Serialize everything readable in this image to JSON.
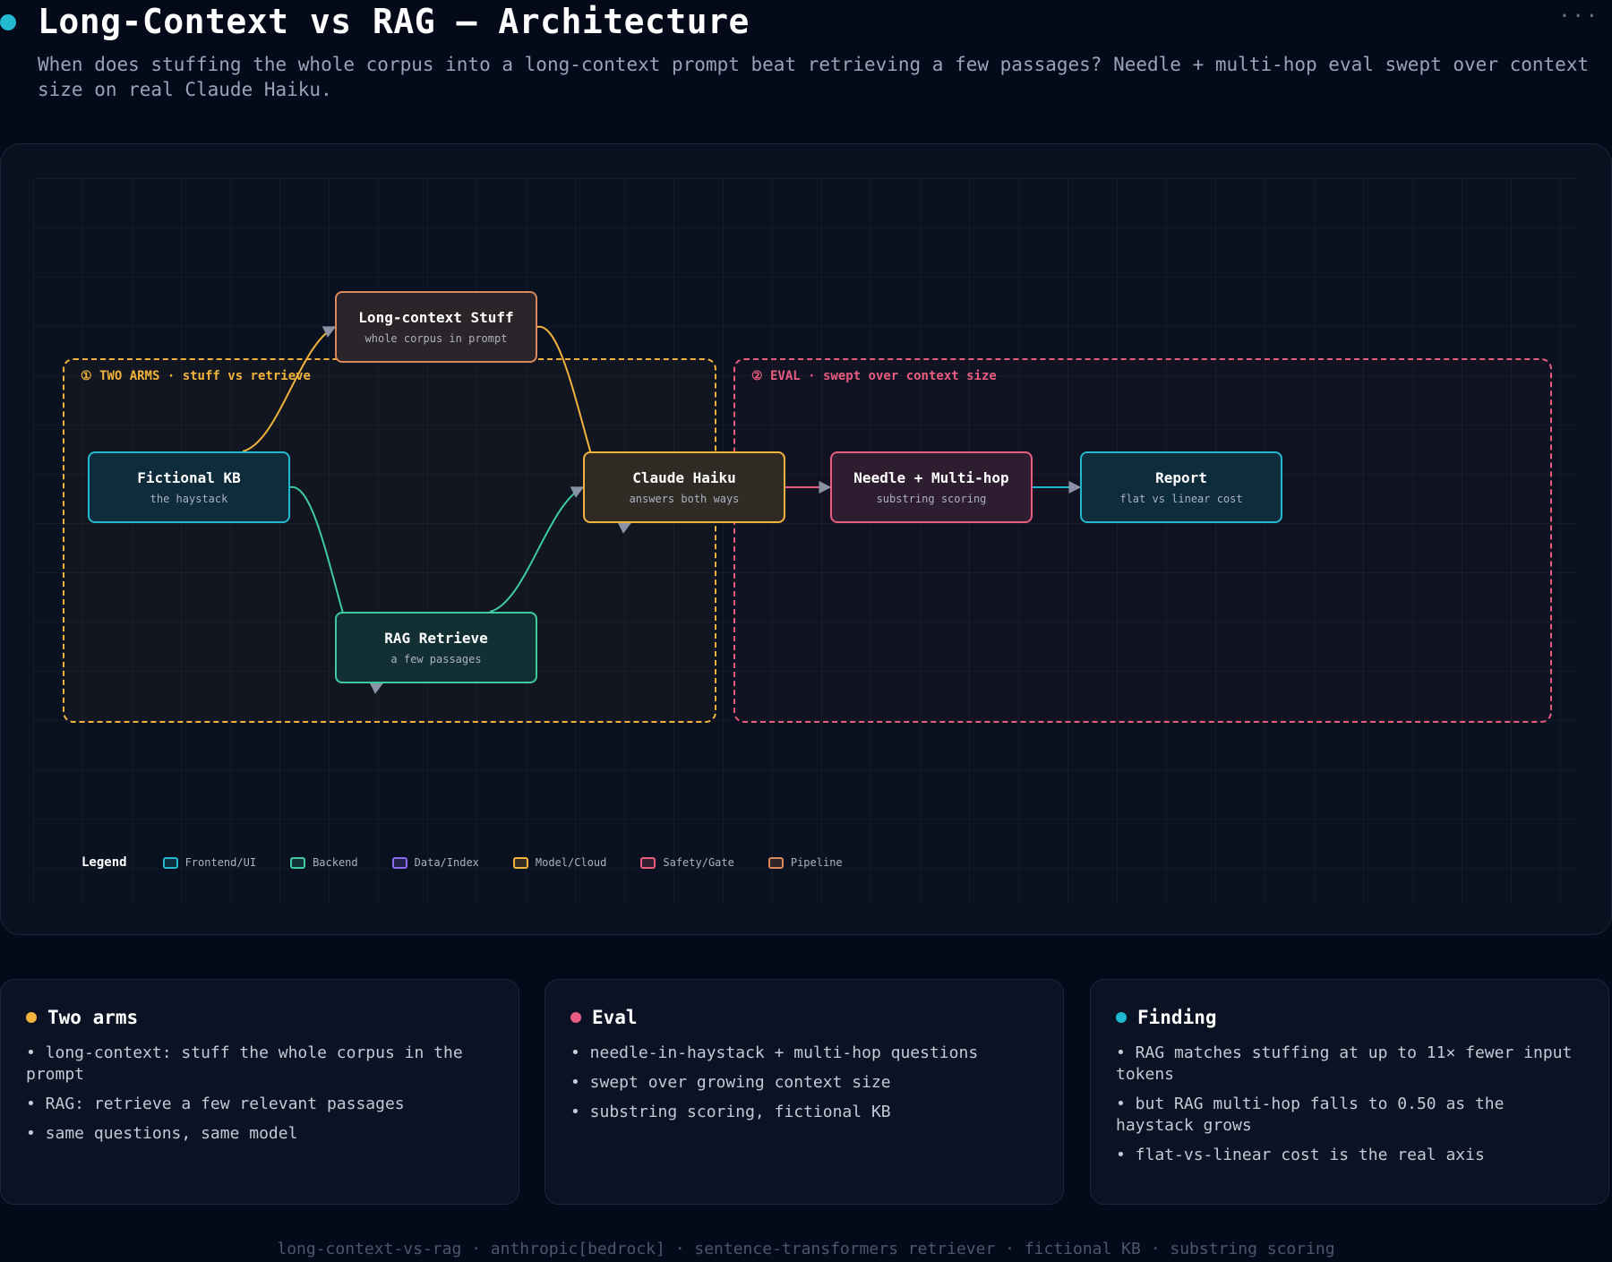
{
  "header": {
    "title": "Long-Context vs RAG — Architecture",
    "subtitle": "When does stuffing the whole corpus into a long-context prompt beat retrieving a few passages? Needle + multi-hop eval swept over context size on real Claude Haiku.",
    "more": "···"
  },
  "diagram": {
    "groups": {
      "two_arms": {
        "label": "① TWO ARMS · stuff vs retrieve",
        "color": "#f2b33d"
      },
      "eval": {
        "label": "② EVAL · swept over context size",
        "color": "#e85d80"
      }
    },
    "nodes": {
      "kb": {
        "title": "Fictional KB",
        "sub": "the haystack",
        "category": "Frontend/UI"
      },
      "stuff": {
        "title": "Long-context Stuff",
        "sub": "whole corpus in prompt",
        "category": "Pipeline"
      },
      "rag": {
        "title": "RAG Retrieve",
        "sub": "a few passages",
        "category": "Backend"
      },
      "haiku": {
        "title": "Claude Haiku",
        "sub": "answers both ways",
        "category": "Model/Cloud"
      },
      "needle": {
        "title": "Needle + Multi-hop",
        "sub": "substring scoring",
        "category": "Safety/Gate"
      },
      "report": {
        "title": "Report",
        "sub": "flat vs linear cost",
        "category": "Frontend/UI"
      }
    },
    "edges": [
      {
        "from": "kb",
        "to": "stuff",
        "color": "#f2b33d"
      },
      {
        "from": "stuff",
        "to": "haiku",
        "color": "#f2b33d"
      },
      {
        "from": "kb",
        "to": "rag",
        "color": "#3fcba0"
      },
      {
        "from": "rag",
        "to": "haiku",
        "color": "#3fcba0"
      },
      {
        "from": "haiku",
        "to": "needle",
        "color": "#e85d80"
      },
      {
        "from": "needle",
        "to": "report",
        "color": "#22b8cf"
      }
    ],
    "legend": {
      "title": "Legend",
      "items": [
        {
          "label": "Frontend/UI",
          "color": "#22b8cf"
        },
        {
          "label": "Backend",
          "color": "#3fcba0"
        },
        {
          "label": "Data/Index",
          "color": "#8b6cf0"
        },
        {
          "label": "Model/Cloud",
          "color": "#f2b33d"
        },
        {
          "label": "Safety/Gate",
          "color": "#e85d80"
        },
        {
          "label": "Pipeline",
          "color": "#d9895a"
        }
      ]
    }
  },
  "cards": [
    {
      "title": "Two arms",
      "dot_color": "#f2b33d",
      "items": [
        "• long-context: stuff the whole corpus in the prompt",
        "• RAG: retrieve a few relevant passages",
        "• same questions, same model"
      ]
    },
    {
      "title": "Eval",
      "dot_color": "#e85d80",
      "items": [
        "• needle-in-haystack + multi-hop questions",
        "• swept over growing context size",
        "• substring scoring, fictional KB"
      ]
    },
    {
      "title": "Finding",
      "dot_color": "#22b8cf",
      "items": [
        "• RAG matches stuffing at up to 11× fewer input tokens",
        "• but RAG multi-hop falls to 0.50 as the haystack grows",
        "• flat-vs-linear cost is the real axis"
      ]
    }
  ],
  "footer": "long-context-vs-rag · anthropic[bedrock] · sentence-transformers retriever · fictional KB · substring scoring"
}
